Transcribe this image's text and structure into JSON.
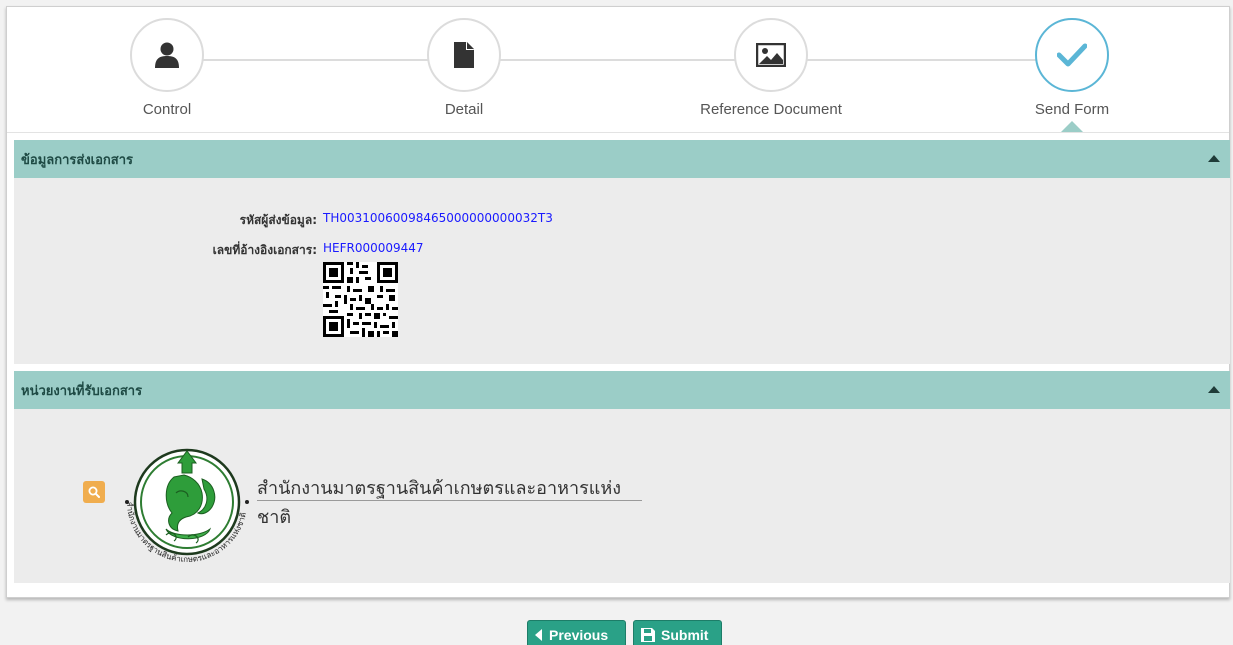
{
  "wizard": {
    "steps": [
      {
        "label": "Control",
        "icon": "user-icon"
      },
      {
        "label": "Detail",
        "icon": "file-icon"
      },
      {
        "label": "Reference Document",
        "icon": "image-icon"
      },
      {
        "label": "Send Form",
        "icon": "check-icon"
      }
    ],
    "active_step": "Send Form"
  },
  "panel_send": {
    "title": "ข้อมูลการส่งเอกสาร",
    "sender_label": "รหัสผู้ส่งข้อมูล:",
    "sender_value": "TH00310060098465000000000032T3",
    "ref_label": "เลขที่อ้างอิงเอกสาร:",
    "ref_value": "HEFR000009447"
  },
  "panel_agency": {
    "title": "หน่วยงานที่รับเอกสาร",
    "agency_name": "สำนักงานมาตรฐานสินค้าเกษตรและอาหารแห่งชาติ",
    "logo_ring_text": "สำนักงานมาตรฐานสินค้าเกษตรและอาหารแห่งชาติ"
  },
  "buttons": {
    "previous": "Previous",
    "submit": "Submit"
  },
  "colors": {
    "panel_header": "#9bcdc7",
    "button": "#2aa187",
    "link": "#1a1aff",
    "active_step": "#5bb6d6",
    "search_button": "#f0ad4e"
  }
}
